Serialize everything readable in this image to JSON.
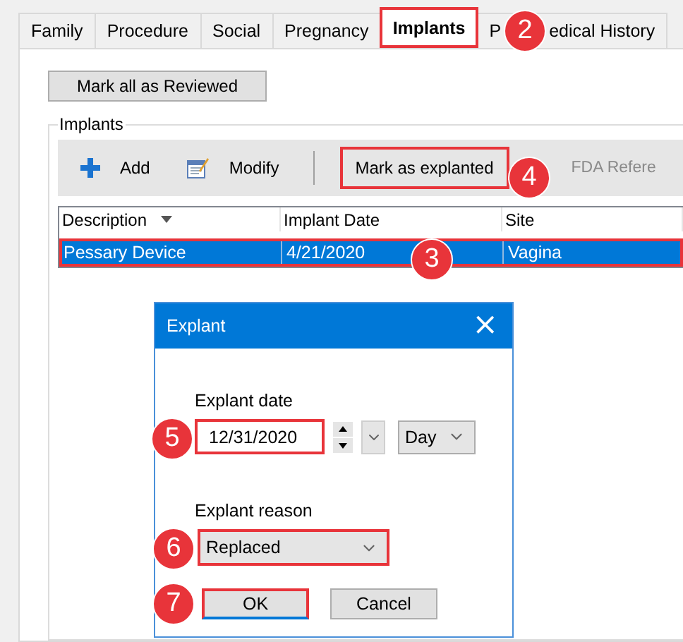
{
  "tabs": [
    {
      "label": "Family",
      "selected": false
    },
    {
      "label": "Procedure",
      "selected": false
    },
    {
      "label": "Social",
      "selected": false
    },
    {
      "label": "Pregnancy",
      "selected": false
    },
    {
      "label": "Implants",
      "selected": true,
      "highlighted": true,
      "callout": "2"
    },
    {
      "label_start": "P",
      "label_end": "edical History",
      "selected": false
    }
  ],
  "review_button": "Mark all as Reviewed",
  "group": {
    "title": "Implants",
    "toolbar": [
      {
        "kind": "add",
        "label": "Add"
      },
      {
        "kind": "modify",
        "label": "Modify"
      },
      {
        "kind": "separator"
      },
      {
        "kind": "button",
        "label": "Mark as explanted",
        "highlighted": true,
        "callout": "4",
        "disabled": false
      },
      {
        "kind": "button",
        "label": "FDA Refere",
        "disabled": true
      }
    ]
  },
  "table": {
    "columns": [
      {
        "label": "Description",
        "sorted": true
      },
      {
        "label": "Implant Date",
        "sorted": false
      },
      {
        "label": "Site",
        "sorted": false
      }
    ],
    "rows": [
      {
        "cells": [
          "Pessary Device",
          "4/21/2020",
          "Vagina"
        ],
        "selected": true,
        "highlighted": true,
        "callout": "3"
      }
    ]
  },
  "dialog": {
    "title": "Explant",
    "close": "×",
    "date_label": "Explant date",
    "date_value": "12/31/2020",
    "date_callout": "5",
    "date_highlighted": true,
    "unit": "Day",
    "reason_label": "Explant reason",
    "reason_value": "Replaced",
    "reason_callout": "6",
    "reason_highlighted": true,
    "buttons": [
      {
        "label": "OK",
        "highlighted": true,
        "callout": "7"
      },
      {
        "label": "Cancel",
        "highlighted": false
      }
    ]
  }
}
